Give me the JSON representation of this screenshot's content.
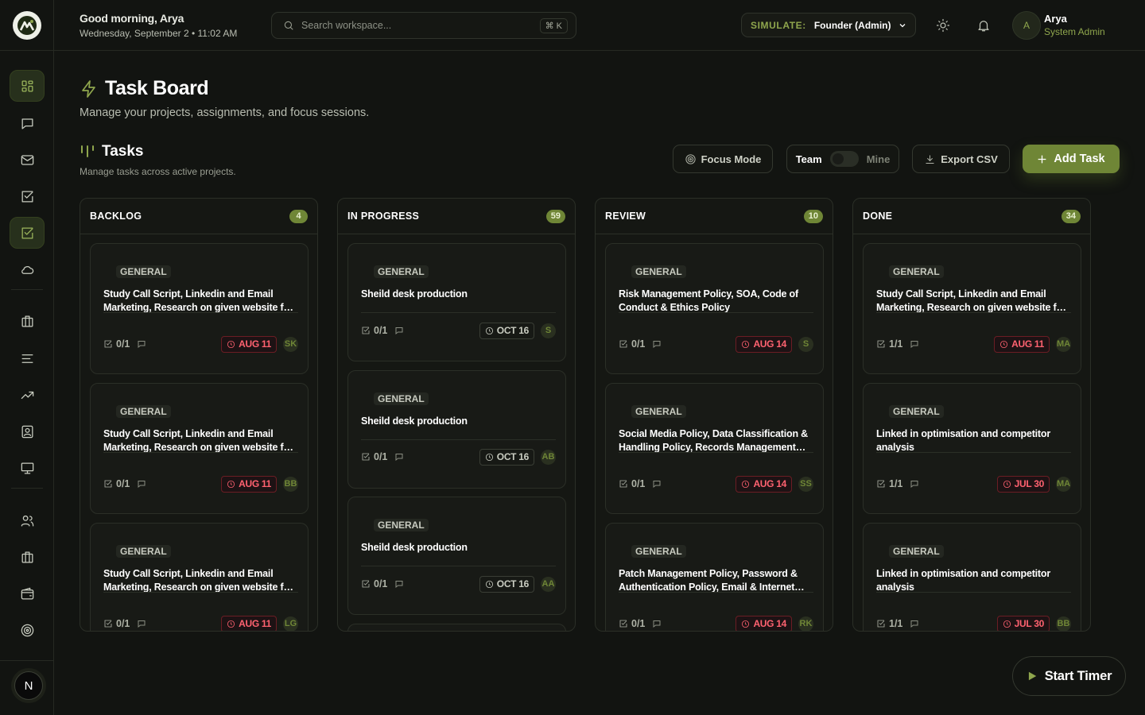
{
  "header": {
    "greeting": "Good morning, Arya",
    "date": "Wednesday, September 2 • 11:02 AM",
    "search": {
      "placeholder": "Search workspace...",
      "shortcut": "⌘ K"
    },
    "simulate": {
      "label": "SIMULATE:",
      "value": "Founder (Admin)"
    },
    "user": {
      "initial": "A",
      "name": "Arya",
      "role": "System Admin"
    }
  },
  "sidebar": {
    "user_initial": "N",
    "icons": [
      "dashboard-icon",
      "chat-icon",
      "mail-icon",
      "checkbox-icon",
      "tasks-icon",
      "cloud-icon",
      "building-icon",
      "list-icon",
      "trend-icon",
      "contact-icon",
      "monitor-icon",
      "users-icon",
      "briefcase-icon",
      "wallet-icon",
      "target-icon"
    ],
    "active": "tasks-icon"
  },
  "page": {
    "title": "Task Board",
    "subtitle": "Manage your projects, assignments, and focus sessions."
  },
  "section": {
    "title": "Tasks",
    "subtitle": "Manage tasks across active projects."
  },
  "toolbar": {
    "focus_mode": "Focus Mode",
    "team": "Team",
    "mine": "Mine",
    "export": "Export CSV",
    "add_task": "Add Task"
  },
  "colors": {
    "accent": "#6f8636",
    "overdue": "#ff6270",
    "background": "#121411"
  },
  "columns": [
    {
      "title": "BACKLOG",
      "count": "4",
      "cards": [
        {
          "tag": "GENERAL",
          "title": "Study Call Script, Linkedin and Email Marketing, Research on given website for new leads",
          "progress": "0/1",
          "due": "AUG 11",
          "status": "overdue",
          "assignee": "SK"
        },
        {
          "tag": "GENERAL",
          "title": "Study Call Script, Linkedin and Email Marketing, Research on given website for new leads",
          "progress": "0/1",
          "due": "AUG 11",
          "status": "overdue",
          "assignee": "BB"
        },
        {
          "tag": "GENERAL",
          "title": "Study Call Script, Linkedin and Email Marketing, Research on given website for new leads",
          "progress": "0/1",
          "due": "AUG 11",
          "status": "overdue",
          "assignee": "LG"
        }
      ]
    },
    {
      "title": "IN PROGRESS",
      "count": "59",
      "cards": [
        {
          "tag": "GENERAL",
          "title": "Sheild desk production",
          "progress": "0/1",
          "due": "OCT 16",
          "status": "upcoming",
          "assignee": "S"
        },
        {
          "tag": "GENERAL",
          "title": "Sheild desk production",
          "progress": "0/1",
          "due": "OCT 16",
          "status": "upcoming",
          "assignee": "AB"
        },
        {
          "tag": "GENERAL",
          "title": "Sheild desk production",
          "progress": "0/1",
          "due": "OCT 16",
          "status": "upcoming",
          "assignee": "AA"
        }
      ]
    },
    {
      "title": "REVIEW",
      "count": "10",
      "cards": [
        {
          "tag": "GENERAL",
          "title": "Risk Management Policy, SOA, Code of Conduct & Ethics Policy",
          "progress": "0/1",
          "due": "AUG 14",
          "status": "overdue",
          "assignee": "S"
        },
        {
          "tag": "GENERAL",
          "title": "Social Media Policy, Data Classification & Handling Policy, Records Management Policy",
          "progress": "0/1",
          "due": "AUG 14",
          "status": "overdue",
          "assignee": "SS"
        },
        {
          "tag": "GENERAL",
          "title": "Patch Management Policy, Password & Authentication Policy, Email & Internet Policy",
          "progress": "0/1",
          "due": "AUG 14",
          "status": "overdue",
          "assignee": "RK"
        }
      ]
    },
    {
      "title": "DONE",
      "count": "34",
      "cards": [
        {
          "tag": "GENERAL",
          "title": "Study Call Script, Linkedin and Email Marketing, Research on given website for new leads",
          "progress": "1/1",
          "due": "AUG 11",
          "status": "overdue",
          "assignee": "MA"
        },
        {
          "tag": "GENERAL",
          "title": "Linked in optimisation and competitor analysis",
          "progress": "1/1",
          "due": "JUL 30",
          "status": "overdue",
          "assignee": "MA"
        },
        {
          "tag": "GENERAL",
          "title": "Linked in optimisation and competitor analysis",
          "progress": "1/1",
          "due": "JUL 30",
          "status": "overdue",
          "assignee": "BB"
        }
      ]
    }
  ],
  "timer": {
    "label": "Start Timer"
  }
}
